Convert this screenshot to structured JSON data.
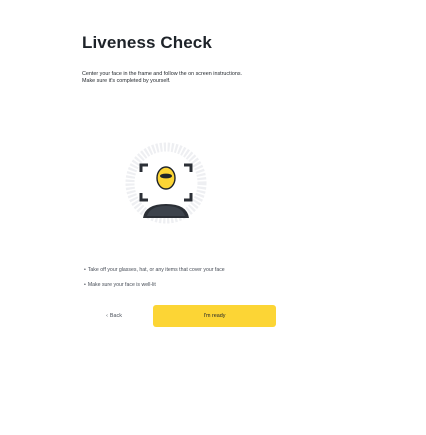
{
  "header": {
    "title": "Liveness Check"
  },
  "instructions": {
    "line1": "Center your face in the frame and follow the on screen instructions.",
    "line2": "Make sure it's completed by yourself."
  },
  "illustration": {
    "icon": "face-scan-icon",
    "colors": {
      "ring": "#eeeff2",
      "corners": "#2b2f36",
      "face": "#fcd535",
      "face_stroke": "#1e2329"
    }
  },
  "tips": [
    {
      "bullet": "•",
      "text": "Take off your glasses, hat, or any items that cover your face"
    },
    {
      "bullet": "•",
      "text": "Make sure your face is well-lit"
    }
  ],
  "actions": {
    "back_icon": "chevron-left-icon",
    "back_chevron": "‹",
    "back_label": "Back",
    "primary_label": "I'm ready"
  },
  "colors": {
    "accent": "#fcd535",
    "text_primary": "#1e2329",
    "text_secondary": "#474d57"
  }
}
